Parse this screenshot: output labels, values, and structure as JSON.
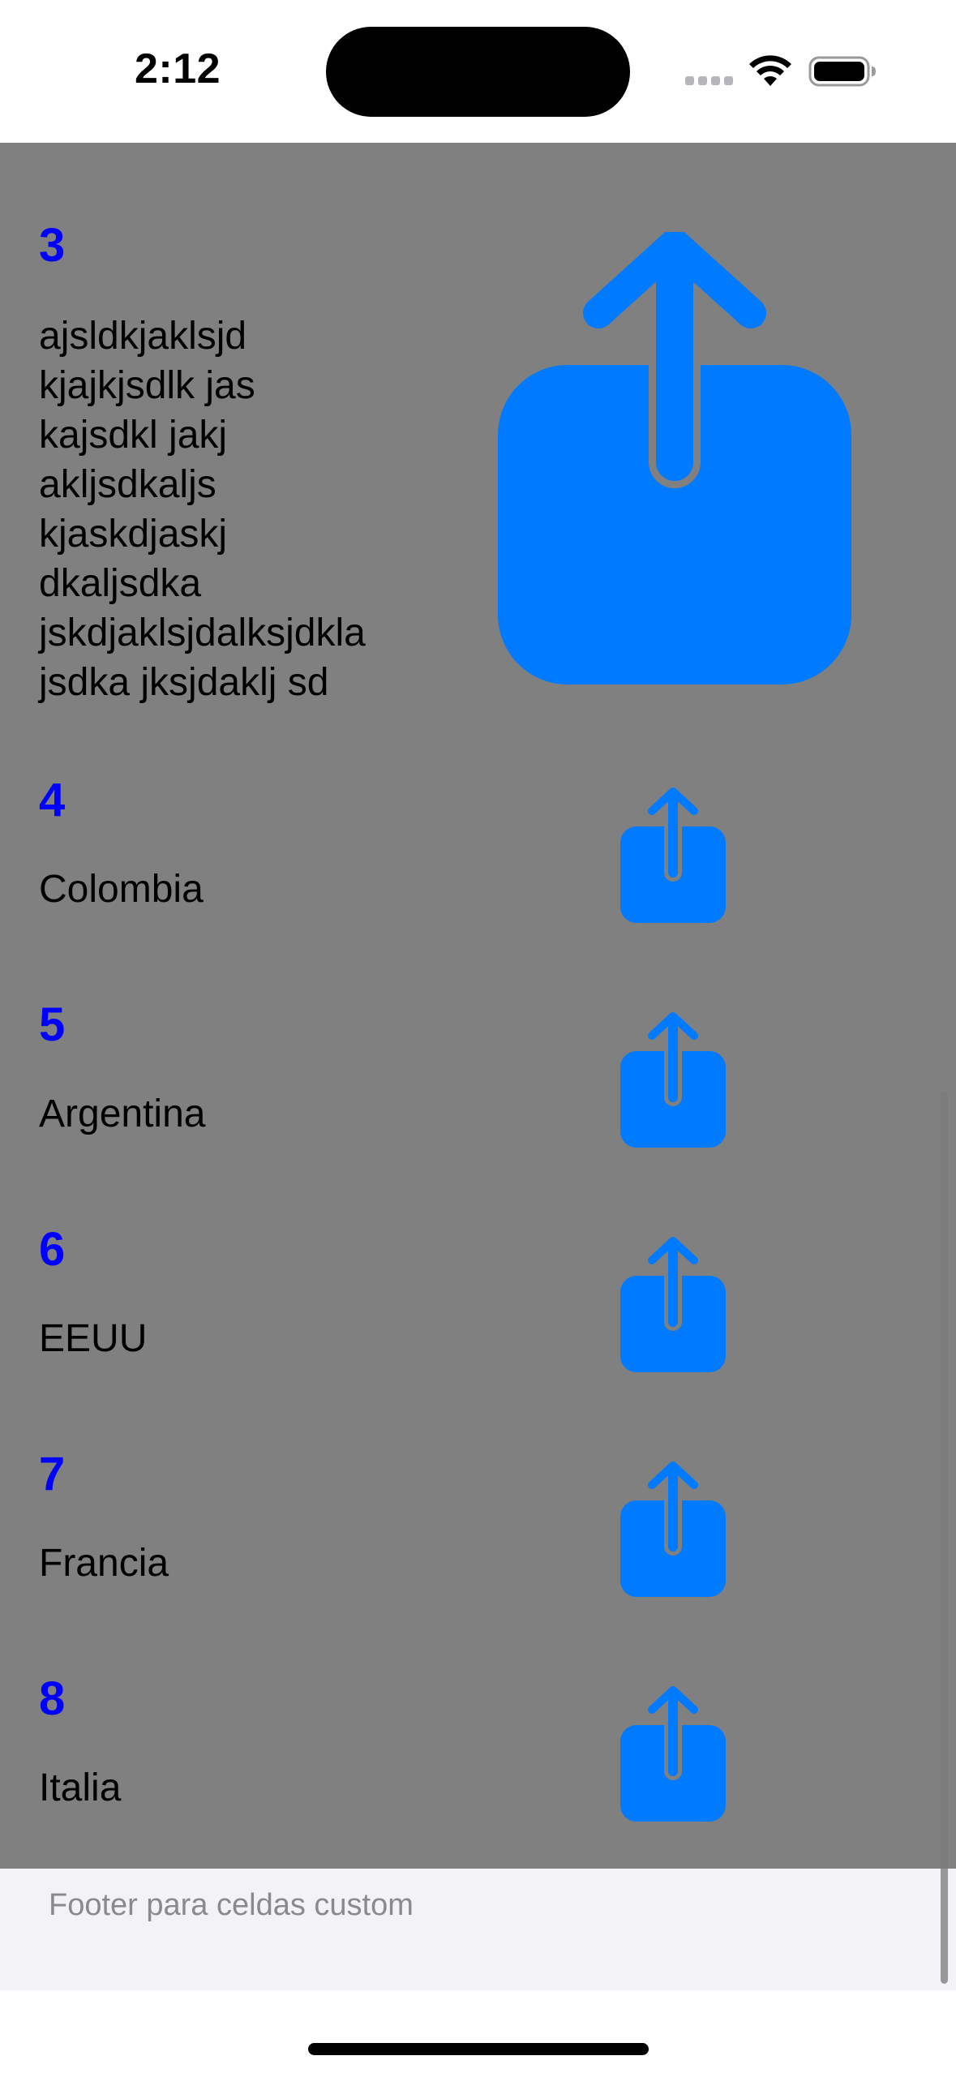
{
  "status_bar": {
    "time": "2:12"
  },
  "table": {
    "background": "#808080",
    "accent": "#007aff",
    "number_color": "#0000ff",
    "cells": [
      {
        "number": "3",
        "text": "ajsldkjaklsjd\nkjajkjsdlk jas\nkajsdkl jakj\nakljsdkaljs\nkjaskdjaskj\ndkaljsdka\njskdjaklsjdalksjdkla\njsdka jksjdaklj sd",
        "icon": "share-icon"
      },
      {
        "number": "4",
        "text": "Colombia",
        "icon": "share-icon"
      },
      {
        "number": "5",
        "text": "Argentina",
        "icon": "share-icon"
      },
      {
        "number": "6",
        "text": "EEUU",
        "icon": "share-icon"
      },
      {
        "number": "7",
        "text": "Francia",
        "icon": "share-icon"
      },
      {
        "number": "8",
        "text": "Italia",
        "icon": "share-icon"
      }
    ]
  },
  "footer": {
    "text": "Footer para celdas custom"
  }
}
